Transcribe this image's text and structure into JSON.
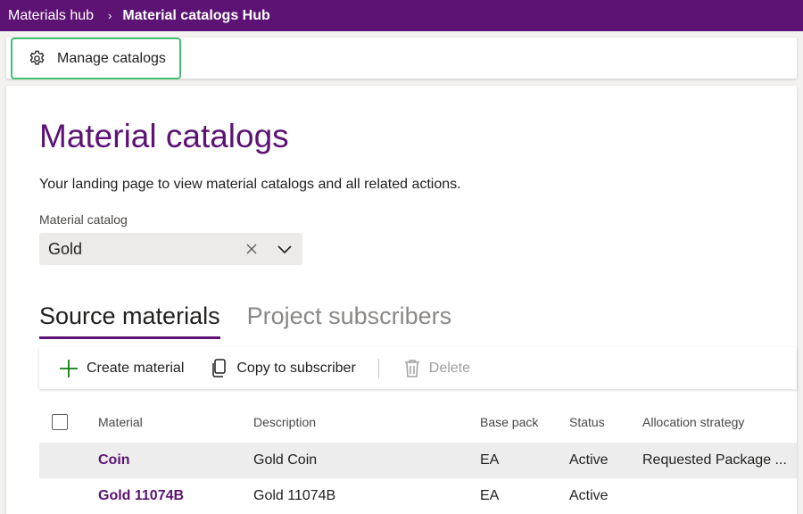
{
  "breadcrumb": {
    "root": "Materials hub",
    "separator": "›",
    "current": "Material catalogs Hub"
  },
  "commandbar": {
    "manage_label": "Manage catalogs",
    "manage_icon": "gear-icon"
  },
  "page": {
    "title": "Material catalogs",
    "description": "Your landing page to view material catalogs and all related actions.",
    "field_label": "Material catalog",
    "dropdown_value": "Gold"
  },
  "tabs": [
    {
      "label": "Source materials",
      "active": true
    },
    {
      "label": "Project subscribers",
      "active": false
    }
  ],
  "toolbar": {
    "create_label": "Create material",
    "copy_label": "Copy to subscriber",
    "delete_label": "Delete"
  },
  "table": {
    "headers": [
      "Material",
      "Description",
      "Base pack",
      "Status",
      "Allocation strategy"
    ],
    "rows": [
      {
        "material": "Coin",
        "description": "Gold Coin",
        "base_pack": "EA",
        "status": "Active",
        "allocation": "Requested Package ..."
      },
      {
        "material": "Gold 11074B",
        "description": "Gold 11074B",
        "base_pack": "EA",
        "status": "Active",
        "allocation": ""
      }
    ]
  },
  "colors": {
    "brand": "#5c1373",
    "focus_outline": "#3fbf6f",
    "add_icon": "#107c10"
  }
}
